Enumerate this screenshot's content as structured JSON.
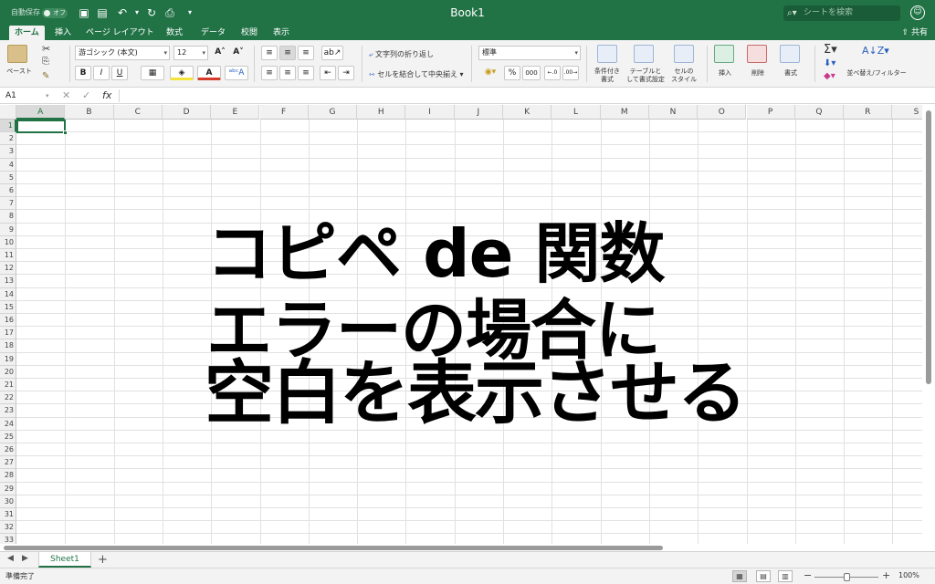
{
  "app": {
    "title": "Book1",
    "autosave_label": "自動保存",
    "autosave_state": "オフ",
    "search_placeholder": "シートを検索",
    "brand_color": "#217346"
  },
  "tabs": [
    {
      "label": "ホーム",
      "active": true
    },
    {
      "label": "挿入"
    },
    {
      "label": "ページ レイアウト"
    },
    {
      "label": "数式"
    },
    {
      "label": "データ"
    },
    {
      "label": "校閲"
    },
    {
      "label": "表示"
    }
  ],
  "share_label": "共有",
  "ribbon": {
    "paste_label": "ペースト",
    "font_name": "游ゴシック (本文)",
    "font_size": "12",
    "wrap_text_label": "文字列の折り返し",
    "merge_center_label": "セルを結合して中央揃え",
    "number_format": "標準",
    "conditional_format_label_1": "条件付き",
    "conditional_format_label_2": "書式",
    "format_table_label_1": "テーブルと",
    "format_table_label_2": "して書式設定",
    "cell_styles_label_1": "セルの",
    "cell_styles_label_2": "スタイル",
    "insert_label": "挿入",
    "delete_label": "削除",
    "format_label": "書式",
    "sort_filter_label": "並べ替え/フィルター",
    "bold": "B",
    "italic": "I",
    "underline": "U",
    "percent": "%",
    "comma": "000"
  },
  "formula_bar": {
    "name_box": "A1",
    "fx": "fx",
    "value": ""
  },
  "columns": [
    "A",
    "B",
    "C",
    "D",
    "E",
    "F",
    "G",
    "H",
    "I",
    "J",
    "K",
    "L",
    "M",
    "N",
    "O",
    "P",
    "Q",
    "R",
    "S"
  ],
  "rows": [
    "1",
    "2",
    "3",
    "4",
    "5",
    "6",
    "7",
    "8",
    "9",
    "10",
    "11",
    "12",
    "13",
    "14",
    "15",
    "16",
    "17",
    "18",
    "19",
    "20",
    "21",
    "22",
    "23",
    "24",
    "25",
    "26",
    "27",
    "28",
    "29",
    "30",
    "31",
    "32",
    "33"
  ],
  "overlay_text": {
    "line1": "コピペ de 関数",
    "line2": "エラーの場合に",
    "line3": "空白を表示させる"
  },
  "sheets": [
    {
      "name": "Sheet1",
      "active": true
    }
  ],
  "status": {
    "text": "準備完了",
    "zoom": "100%",
    "zoom_fraction": 0.5
  }
}
